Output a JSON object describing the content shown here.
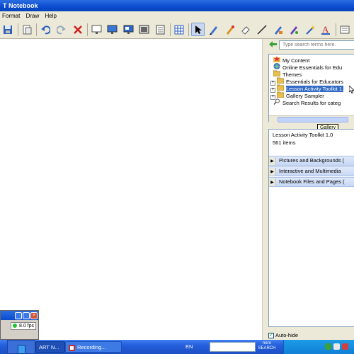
{
  "window": {
    "title": "T Notebook"
  },
  "menu": {
    "items": [
      "Format",
      "Draw",
      "Help"
    ]
  },
  "toolbar": {
    "buttons": [
      "save-icon",
      "page-icon",
      "undo-icon",
      "redo-icon",
      "delete-icon",
      "screen-shade-icon",
      "display-icon",
      "capture-icon",
      "capture-area-icon",
      "table-icon",
      "select-icon",
      "pen-icon",
      "creative-pen-icon",
      "eraser-icon",
      "line-icon",
      "shapes-icon",
      "fill-icon",
      "magic-pen-icon",
      "text-icon"
    ]
  },
  "gallery": {
    "search_placeholder": "Type search terms here.",
    "tree": [
      {
        "label": "My Content",
        "expandable": false,
        "icon": "star-folder-icon"
      },
      {
        "label": "Online Essentials for Edu",
        "expandable": false,
        "icon": "globe-icon"
      },
      {
        "label": "Themes",
        "expandable": false,
        "icon": "folder-icon"
      },
      {
        "label": "Essentials for Educators",
        "expandable": true,
        "icon": "folder-icon"
      },
      {
        "label": "Lesson Activity Toolkit 1.",
        "expandable": true,
        "icon": "folder-icon",
        "selected": true
      },
      {
        "label": "Gallery Sampler",
        "expandable": true,
        "icon": "folder-icon"
      },
      {
        "label": "Search Results for categ",
        "expandable": false,
        "icon": "search-icon"
      }
    ],
    "tooltip": "Gallery",
    "collection_title": "Lesson Activity Toolkit 1.0",
    "collection_count": "561 items",
    "sections": [
      "Pictures and Backgrounds (",
      "Interactive and Multimedia",
      "Notebook Files and Pages ("
    ],
    "autohide_label": "Auto-hide",
    "autohide_checked": true
  },
  "recorder": {
    "fps": "8.0 fps"
  },
  "taskbar": {
    "tasks": [
      "ART N...",
      "Recording..."
    ],
    "language": "EN",
    "nero_label": "nero SEARCH"
  },
  "colors": {
    "title_blue": "#0a4bd0",
    "selection_blue": "#316ac5",
    "taskbar_blue": "#245edb"
  }
}
